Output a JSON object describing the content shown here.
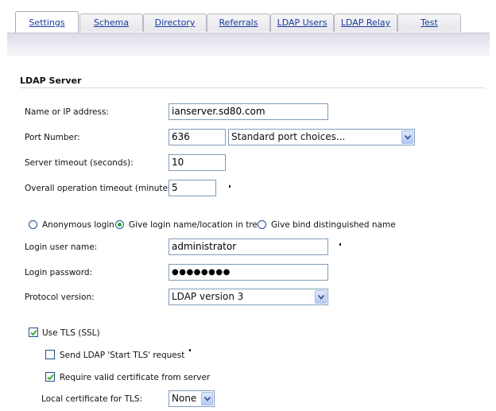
{
  "tabs": [
    {
      "label": "Settings",
      "active": true
    },
    {
      "label": "Schema"
    },
    {
      "label": "Directory"
    },
    {
      "label": "Referrals"
    },
    {
      "label": "LDAP Users"
    },
    {
      "label": "LDAP Relay"
    },
    {
      "label": "Test"
    }
  ],
  "section": {
    "title": "LDAP Server"
  },
  "fields": {
    "name_label": "Name or IP address:",
    "name_value": "ianserver.sd80.com",
    "port_label": "Port Number:",
    "port_value": "636",
    "port_choices_value": "Standard port choices...",
    "server_timeout_label": "Server timeout (seconds):",
    "server_timeout_value": "10",
    "overall_timeout_label": "Overall operation timeout (minutes):",
    "overall_timeout_value": "5"
  },
  "login_mode": {
    "options": [
      "Anonymous login",
      "Give login name/location in tree",
      "Give bind distinguished name"
    ],
    "selected": "Give login name/location in tree"
  },
  "login": {
    "user_label": "Login user name:",
    "user_value": "administrator",
    "password_label": "Login password:",
    "password_value": "●●●●●●●●",
    "protocol_label": "Protocol version:",
    "protocol_value": "LDAP version 3"
  },
  "tls": {
    "use_tls_label": "Use TLS (SSL)",
    "use_tls_checked": true,
    "start_tls_label": "Send LDAP 'Start TLS' request",
    "start_tls_checked": false,
    "require_cert_label": "Require valid certificate from server",
    "require_cert_checked": true,
    "local_cert_label": "Local certificate for TLS:",
    "local_cert_value": "None"
  },
  "colors": {
    "tab_link": "#1b3b9c",
    "input_border": "#7f9db9",
    "radio_selected": "#2fa82f",
    "check": "#2fa82f"
  }
}
